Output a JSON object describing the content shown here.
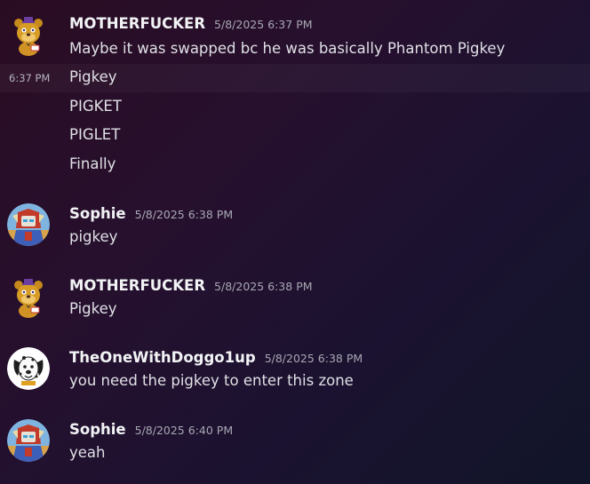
{
  "messages": [
    {
      "author": "MOTHERFUCKER",
      "timestamp": "5/8/2025 6:37 PM",
      "avatar_icon": "golden-bear-plush-icon",
      "lines": [
        "Maybe it was swapped bc he was basically Phantom Pigkey",
        "Pigkey",
        "PIGKET",
        "PIGLET",
        "Finally"
      ],
      "hover_time": "6:37 PM"
    },
    {
      "author": "Sophie",
      "timestamp": "5/8/2025 6:38 PM",
      "avatar_icon": "robot-character-icon",
      "lines": [
        "pigkey"
      ]
    },
    {
      "author": "MOTHERFUCKER",
      "timestamp": "5/8/2025 6:38 PM",
      "avatar_icon": "golden-bear-plush-icon",
      "lines": [
        "Pigkey"
      ]
    },
    {
      "author": "TheOneWithDoggo1up",
      "timestamp": "5/8/2025 6:38 PM",
      "avatar_icon": "dalmatian-dog-icon",
      "lines": [
        "you need the pigkey to enter this zone"
      ]
    },
    {
      "author": "Sophie",
      "timestamp": "5/8/2025 6:40 PM",
      "avatar_icon": "robot-character-icon",
      "lines": [
        "yeah"
      ]
    }
  ]
}
